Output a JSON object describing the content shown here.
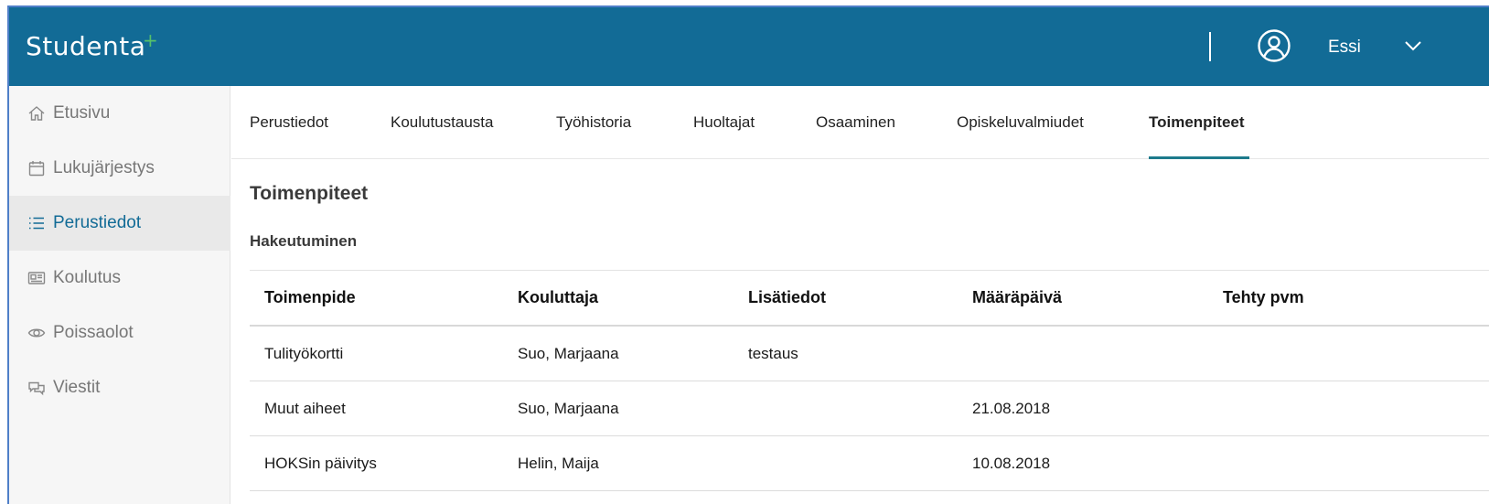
{
  "header": {
    "logo_text": "Studenta",
    "logo_plus": "+",
    "user_name": "Essi",
    "user_icon": "user-circle-icon",
    "menu_icon": "chevron-down-icon"
  },
  "sidebar": {
    "items": [
      {
        "label": "Etusivu",
        "icon": "home-icon"
      },
      {
        "label": "Lukujärjestys",
        "icon": "calendar-icon"
      },
      {
        "label": "Perustiedot",
        "icon": "list-icon",
        "active": true
      },
      {
        "label": "Koulutus",
        "icon": "newspaper-icon"
      },
      {
        "label": "Poissaolot",
        "icon": "eye-icon"
      },
      {
        "label": "Viestit",
        "icon": "chat-icon"
      }
    ]
  },
  "tabs": [
    {
      "label": "Perustiedot"
    },
    {
      "label": "Koulutustausta"
    },
    {
      "label": "Työhistoria"
    },
    {
      "label": "Huoltajat"
    },
    {
      "label": "Osaaminen"
    },
    {
      "label": "Opiskeluvalmiudet"
    },
    {
      "label": "Toimenpiteet",
      "active": true
    }
  ],
  "page": {
    "title": "Toimenpiteet",
    "section_title": "Hakeutuminen"
  },
  "table": {
    "columns": [
      "Toimenpide",
      "Kouluttaja",
      "Lisätiedot",
      "Määräpäivä",
      "Tehty pvm"
    ],
    "rows": [
      [
        "Tulityökortti",
        "Suo, Marjaana",
        "testaus",
        "",
        ""
      ],
      [
        "Muut aiheet",
        "Suo, Marjaana",
        "",
        "21.08.2018",
        ""
      ],
      [
        "HOKSin päivitys",
        "Helin, Maija",
        "",
        "10.08.2018",
        ""
      ]
    ]
  },
  "colors": {
    "header_bg": "#126b96",
    "accent_green": "#55c16a",
    "active_tab_underline": "#1d7a8c"
  }
}
